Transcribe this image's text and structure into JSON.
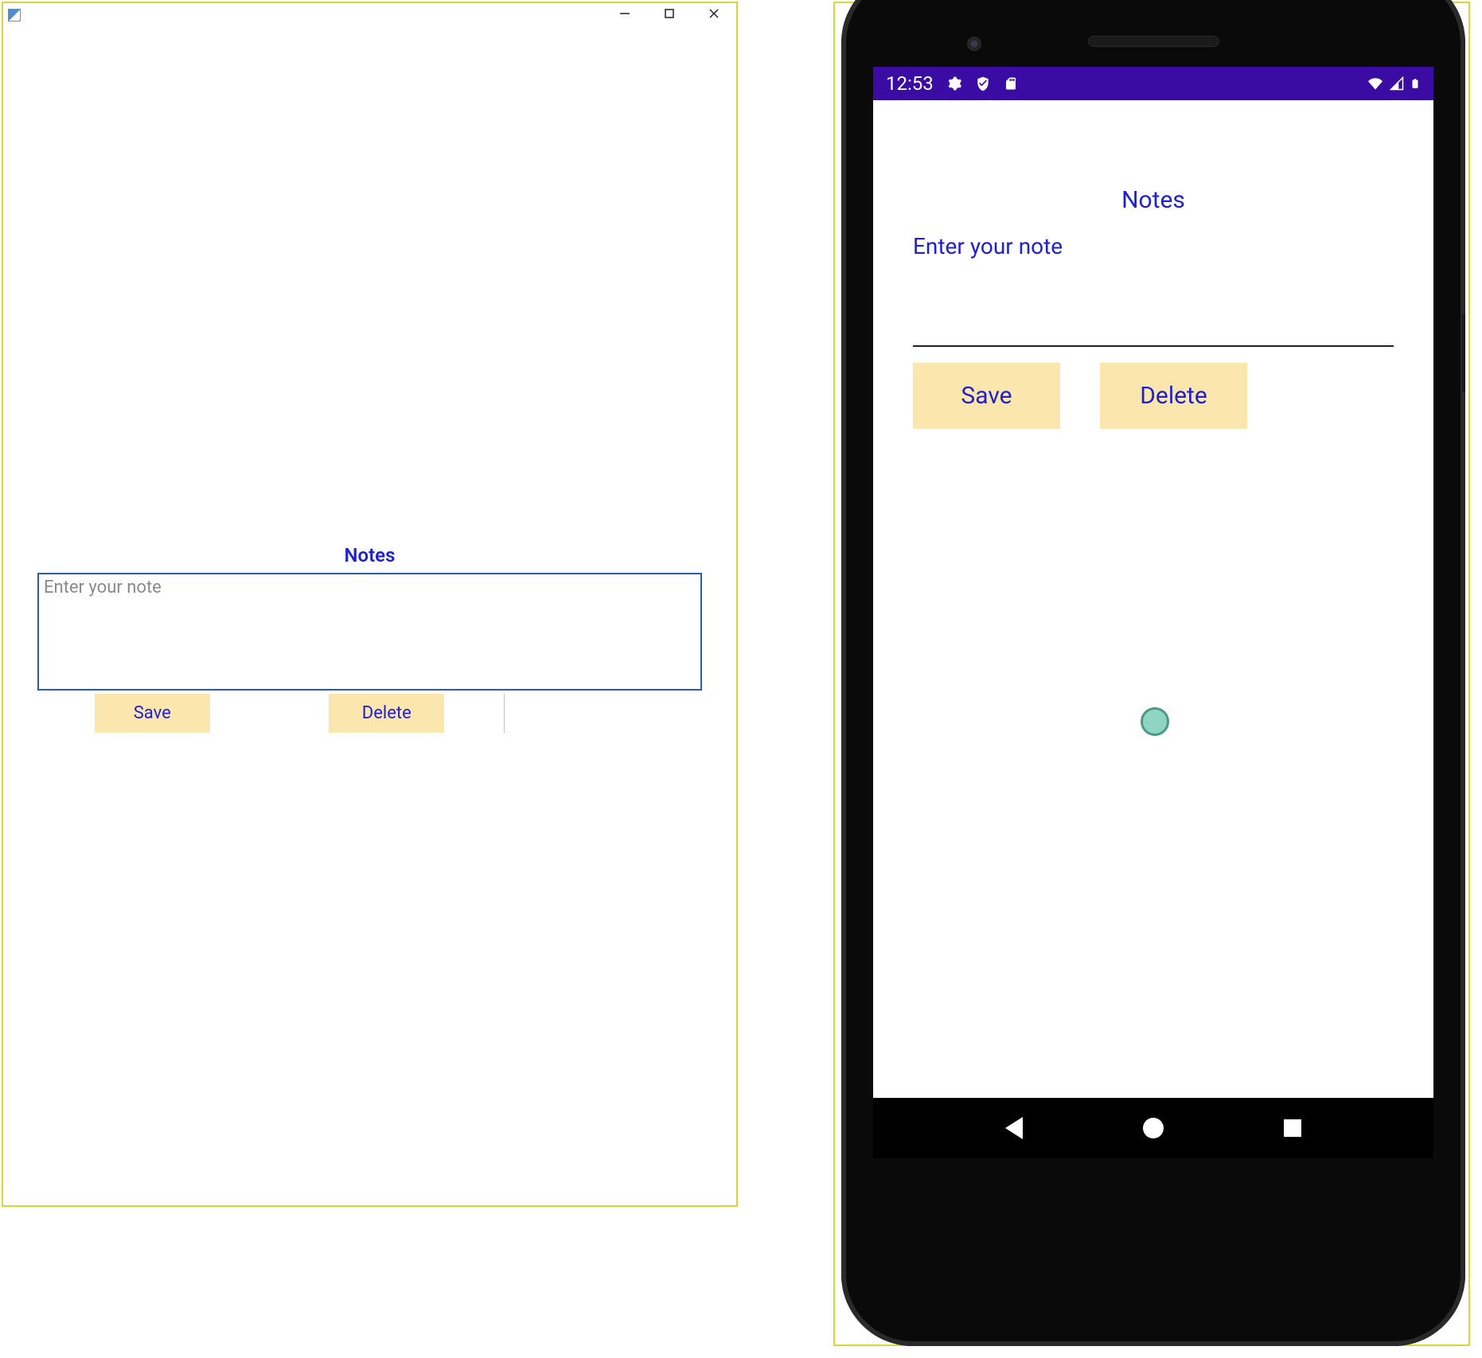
{
  "desktop": {
    "title": "Notes",
    "placeholder": "Enter your note",
    "buttons": {
      "save": "Save",
      "delete": "Delete"
    }
  },
  "mobile": {
    "statusbar": {
      "time": "12:53"
    },
    "title": "Notes",
    "input_label": "Enter your note",
    "buttons": {
      "save": "Save",
      "delete": "Delete"
    }
  }
}
